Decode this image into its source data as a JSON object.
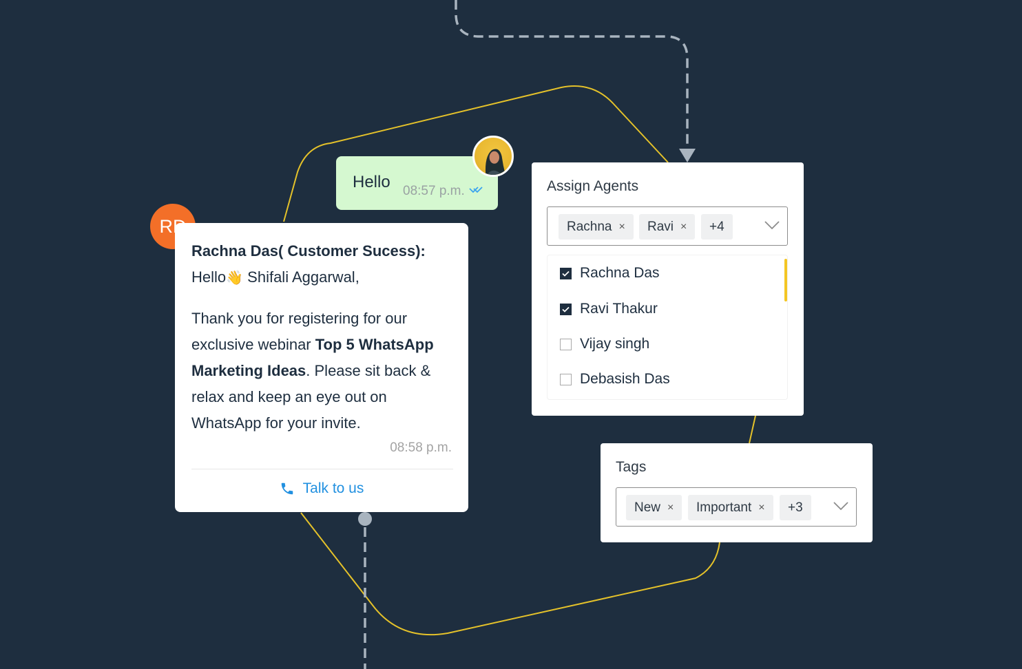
{
  "colors": {
    "background": "#1e2e3f",
    "accent_path": "#e5c22a",
    "connector": "#a9b4bf",
    "sent_bubble": "#d5f8d0",
    "avatar_initials_bg": "#f36f28",
    "link": "#2190e0",
    "scrollbar": "#f4c623"
  },
  "sent_message": {
    "text": "Hello",
    "time": "08:57 p.m.",
    "status_icon": "double-check-icon",
    "avatar": "user-photo"
  },
  "received_message": {
    "avatar_initials": "RD",
    "sender": "Rachna Das( Customer Sucess):",
    "greeting_prefix": "Hello",
    "greeting_emoji": "👋",
    "greeting_name": " Shifali Aggarwal,",
    "body_part1": "Thank you for registering for our exclusive webinar ",
    "body_bold": "Top 5 WhatsApp Marketing Ideas",
    "body_part2": ". Please sit back & relax and keep an eye out on WhatsApp for your invite.",
    "time": "08:58 p.m.",
    "cta_label": "Talk to us",
    "cta_icon": "phone-icon"
  },
  "assign_agents": {
    "title": "Assign Agents",
    "chips": [
      {
        "label": "Rachna",
        "removable": true
      },
      {
        "label": "Ravi",
        "removable": true
      },
      {
        "label": "+4",
        "removable": false
      }
    ],
    "remove_glyph": "×",
    "options": [
      {
        "label": "Rachna Das",
        "checked": true
      },
      {
        "label": "Ravi Thakur",
        "checked": true
      },
      {
        "label": "Vijay singh",
        "checked": false
      },
      {
        "label": "Debasish Das",
        "checked": false
      }
    ]
  },
  "tags": {
    "title": "Tags",
    "chips": [
      {
        "label": "New",
        "removable": true
      },
      {
        "label": "Important",
        "removable": true
      },
      {
        "label": "+3",
        "removable": false
      }
    ],
    "remove_glyph": "×"
  }
}
